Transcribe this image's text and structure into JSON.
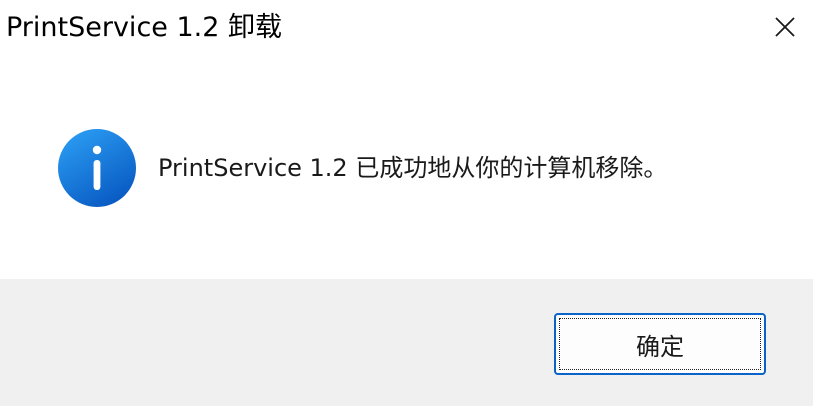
{
  "window": {
    "title": "PrintService 1.2 卸载",
    "close_icon": "close-icon"
  },
  "content": {
    "icon": "info-icon",
    "message": "PrintService 1.2 已成功地从你的计算机移除。"
  },
  "footer": {
    "ok_label": "确定"
  },
  "colors": {
    "accent": "#0a64c8",
    "footer_bg": "#f0f0f0",
    "icon_top": "#2b9af3",
    "icon_bottom": "#0a5fc7"
  }
}
